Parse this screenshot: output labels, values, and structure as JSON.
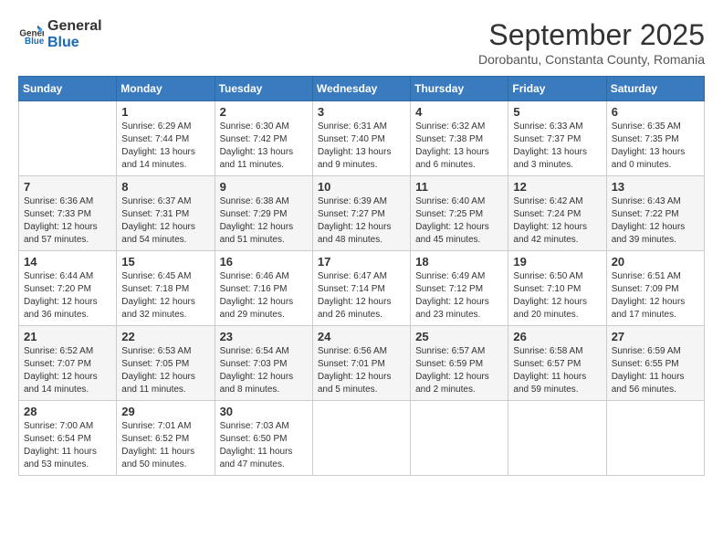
{
  "logo": {
    "line1": "General",
    "line2": "Blue"
  },
  "title": "September 2025",
  "subtitle": "Dorobantu, Constanta County, Romania",
  "days_of_week": [
    "Sunday",
    "Monday",
    "Tuesday",
    "Wednesday",
    "Thursday",
    "Friday",
    "Saturday"
  ],
  "weeks": [
    [
      {
        "day": "",
        "info": ""
      },
      {
        "day": "1",
        "info": "Sunrise: 6:29 AM\nSunset: 7:44 PM\nDaylight: 13 hours\nand 14 minutes."
      },
      {
        "day": "2",
        "info": "Sunrise: 6:30 AM\nSunset: 7:42 PM\nDaylight: 13 hours\nand 11 minutes."
      },
      {
        "day": "3",
        "info": "Sunrise: 6:31 AM\nSunset: 7:40 PM\nDaylight: 13 hours\nand 9 minutes."
      },
      {
        "day": "4",
        "info": "Sunrise: 6:32 AM\nSunset: 7:38 PM\nDaylight: 13 hours\nand 6 minutes."
      },
      {
        "day": "5",
        "info": "Sunrise: 6:33 AM\nSunset: 7:37 PM\nDaylight: 13 hours\nand 3 minutes."
      },
      {
        "day": "6",
        "info": "Sunrise: 6:35 AM\nSunset: 7:35 PM\nDaylight: 13 hours\nand 0 minutes."
      }
    ],
    [
      {
        "day": "7",
        "info": "Sunrise: 6:36 AM\nSunset: 7:33 PM\nDaylight: 12 hours\nand 57 minutes."
      },
      {
        "day": "8",
        "info": "Sunrise: 6:37 AM\nSunset: 7:31 PM\nDaylight: 12 hours\nand 54 minutes."
      },
      {
        "day": "9",
        "info": "Sunrise: 6:38 AM\nSunset: 7:29 PM\nDaylight: 12 hours\nand 51 minutes."
      },
      {
        "day": "10",
        "info": "Sunrise: 6:39 AM\nSunset: 7:27 PM\nDaylight: 12 hours\nand 48 minutes."
      },
      {
        "day": "11",
        "info": "Sunrise: 6:40 AM\nSunset: 7:25 PM\nDaylight: 12 hours\nand 45 minutes."
      },
      {
        "day": "12",
        "info": "Sunrise: 6:42 AM\nSunset: 7:24 PM\nDaylight: 12 hours\nand 42 minutes."
      },
      {
        "day": "13",
        "info": "Sunrise: 6:43 AM\nSunset: 7:22 PM\nDaylight: 12 hours\nand 39 minutes."
      }
    ],
    [
      {
        "day": "14",
        "info": "Sunrise: 6:44 AM\nSunset: 7:20 PM\nDaylight: 12 hours\nand 36 minutes."
      },
      {
        "day": "15",
        "info": "Sunrise: 6:45 AM\nSunset: 7:18 PM\nDaylight: 12 hours\nand 32 minutes."
      },
      {
        "day": "16",
        "info": "Sunrise: 6:46 AM\nSunset: 7:16 PM\nDaylight: 12 hours\nand 29 minutes."
      },
      {
        "day": "17",
        "info": "Sunrise: 6:47 AM\nSunset: 7:14 PM\nDaylight: 12 hours\nand 26 minutes."
      },
      {
        "day": "18",
        "info": "Sunrise: 6:49 AM\nSunset: 7:12 PM\nDaylight: 12 hours\nand 23 minutes."
      },
      {
        "day": "19",
        "info": "Sunrise: 6:50 AM\nSunset: 7:10 PM\nDaylight: 12 hours\nand 20 minutes."
      },
      {
        "day": "20",
        "info": "Sunrise: 6:51 AM\nSunset: 7:09 PM\nDaylight: 12 hours\nand 17 minutes."
      }
    ],
    [
      {
        "day": "21",
        "info": "Sunrise: 6:52 AM\nSunset: 7:07 PM\nDaylight: 12 hours\nand 14 minutes."
      },
      {
        "day": "22",
        "info": "Sunrise: 6:53 AM\nSunset: 7:05 PM\nDaylight: 12 hours\nand 11 minutes."
      },
      {
        "day": "23",
        "info": "Sunrise: 6:54 AM\nSunset: 7:03 PM\nDaylight: 12 hours\nand 8 minutes."
      },
      {
        "day": "24",
        "info": "Sunrise: 6:56 AM\nSunset: 7:01 PM\nDaylight: 12 hours\nand 5 minutes."
      },
      {
        "day": "25",
        "info": "Sunrise: 6:57 AM\nSunset: 6:59 PM\nDaylight: 12 hours\nand 2 minutes."
      },
      {
        "day": "26",
        "info": "Sunrise: 6:58 AM\nSunset: 6:57 PM\nDaylight: 11 hours\nand 59 minutes."
      },
      {
        "day": "27",
        "info": "Sunrise: 6:59 AM\nSunset: 6:55 PM\nDaylight: 11 hours\nand 56 minutes."
      }
    ],
    [
      {
        "day": "28",
        "info": "Sunrise: 7:00 AM\nSunset: 6:54 PM\nDaylight: 11 hours\nand 53 minutes."
      },
      {
        "day": "29",
        "info": "Sunrise: 7:01 AM\nSunset: 6:52 PM\nDaylight: 11 hours\nand 50 minutes."
      },
      {
        "day": "30",
        "info": "Sunrise: 7:03 AM\nSunset: 6:50 PM\nDaylight: 11 hours\nand 47 minutes."
      },
      {
        "day": "",
        "info": ""
      },
      {
        "day": "",
        "info": ""
      },
      {
        "day": "",
        "info": ""
      },
      {
        "day": "",
        "info": ""
      }
    ]
  ]
}
